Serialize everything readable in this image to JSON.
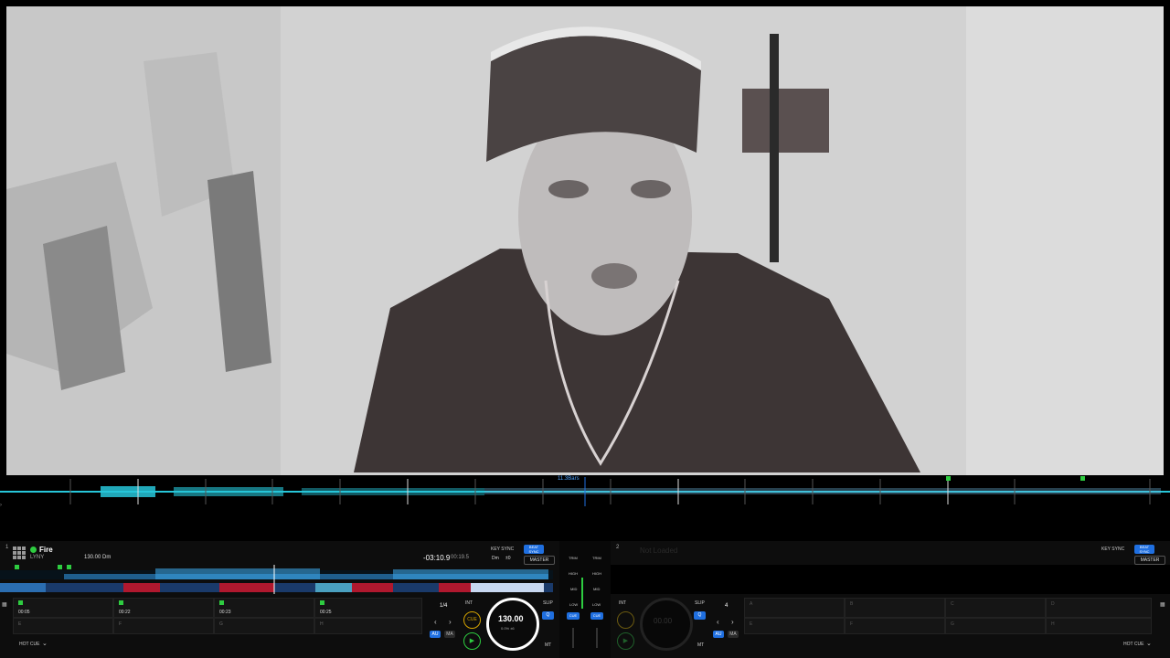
{
  "overview": {
    "position_label": "11.3Bars"
  },
  "deck1": {
    "number": "1",
    "title": "Fire",
    "artist": "LYNY",
    "bpm_key": "130.00 Dm",
    "time_remaining": "-03:10.9",
    "time_elapsed": "00:19.5",
    "key_sync": "KEY SYNC",
    "key_value": "Dm",
    "key_shift": "±0",
    "beat_sync": "BEAT SYNC",
    "master": "MASTER",
    "loop_size": "1/4",
    "int_label": "INT",
    "cue_label": "CUE",
    "au_label": "AU",
    "ma_label": "MA",
    "slip_label": "SLIP",
    "q_label": "Q",
    "mt_label": "MT",
    "hot_cue_label": "HOT CUE",
    "bpm_big": "130.00",
    "pitch": "0.0% ±6",
    "hotcues": [
      {
        "letter": "A",
        "time": "00:05"
      },
      {
        "letter": "B",
        "time": "00:22"
      },
      {
        "letter": "C",
        "time": "00:23"
      },
      {
        "letter": "D",
        "time": "00:25"
      }
    ],
    "hotcues_row2": [
      "E",
      "F",
      "G",
      "H"
    ]
  },
  "mixer": {
    "trim": "TRIM",
    "high": "HIGH",
    "mid": "MID",
    "low": "LOW",
    "cue": "CUE"
  },
  "deck2": {
    "number": "2",
    "title": "Not Loaded",
    "key_sync": "KEY SYNC",
    "beat_sync": "BEAT SYNC",
    "master": "MASTER",
    "loop_size": "4",
    "int_label": "INT",
    "slip_label": "SLIP",
    "q_label": "Q",
    "au_label": "AU",
    "ma_label": "MA",
    "mt_label": "MT",
    "hot_cue_label": "HOT CUE",
    "bpm_big": "00.00",
    "hotcues": [
      "A",
      "B",
      "C",
      "D"
    ],
    "hotcues_row2": [
      "E",
      "F",
      "G",
      "H"
    ]
  },
  "colors": {
    "accent_blue": "#1f6fe0",
    "cue_green": "#2ecc40",
    "waveform_cyan": "#27c6d9"
  }
}
